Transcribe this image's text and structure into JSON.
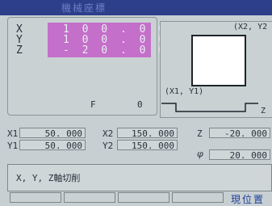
{
  "header": {
    "title": "機械座標"
  },
  "position_display": {
    "axes": [
      {
        "label": "X",
        "value": "1 0 0 . 0 0 0"
      },
      {
        "label": "Y",
        "value": "1 0 0 . 0 0 0"
      },
      {
        "label": "Z",
        "value": "- 2 0 . 0 0 0"
      }
    ],
    "f_label": "F",
    "f_value": "0"
  },
  "toolpath_view": {
    "corner_top": "(X2, Y2",
    "corner_bottom": "(X1, Y1)",
    "z_label": "Z"
  },
  "parameters": {
    "x1": {
      "label": "X1",
      "value": "50. 000"
    },
    "y1": {
      "label": "Y1",
      "value": "50. 000"
    },
    "x2": {
      "label": "X2",
      "value": "150. 000"
    },
    "y2": {
      "label": "Y2",
      "value": "150. 000"
    },
    "z": {
      "label": "Z",
      "value": "-20. 000"
    },
    "phi": {
      "label": "φ",
      "value": "20. 000"
    }
  },
  "message": "X, Y, Z軸切削",
  "softkeys": [
    "",
    "",
    "",
    ""
  ],
  "mode_label": "現位置"
}
